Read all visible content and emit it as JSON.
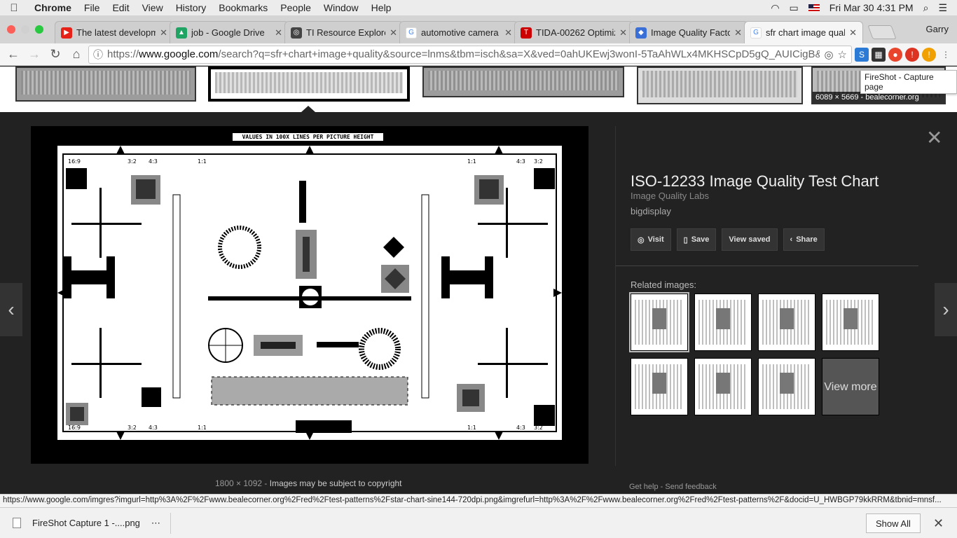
{
  "menubar": {
    "app": "Chrome",
    "items": [
      "File",
      "Edit",
      "View",
      "History",
      "Bookmarks",
      "People",
      "Window",
      "Help"
    ],
    "clock": "Fri Mar 30  4:31 PM"
  },
  "tabs": [
    {
      "label": "The latest developm",
      "icon": "youtube-icon",
      "color": "#e62117"
    },
    {
      "label": "job - Google Drive",
      "icon": "drive-icon",
      "color": "#1fa463"
    },
    {
      "label": "TI Resource Explorer",
      "icon": "compass-icon",
      "color": "#444444"
    },
    {
      "label": "automotive camera t",
      "icon": "google-icon",
      "color": "#4285f4"
    },
    {
      "label": "TIDA-00262 Optimiz",
      "icon": "ti-icon",
      "color": "#cc0000"
    },
    {
      "label": "Image Quality Factor",
      "icon": "imatest-icon",
      "color": "#3b6fd8"
    },
    {
      "label": "sfr chart image quali",
      "icon": "google-icon",
      "color": "#4285f4"
    }
  ],
  "profile": "Garry",
  "omnibox": {
    "scheme": "https://",
    "host": "www.google.com",
    "path": "/search?q=sfr+chart+image+quality&source=lnms&tbm=isch&sa=X&ved=0ahUKEwj3wonI-5TaAhWLx4MKHSCpD5gQ_AUICigB&b..."
  },
  "tooltip": "FireShot - Capture page",
  "strip_caption": "6089 × 5669 - bealecorner.org",
  "chart_header": "VALUES IN 100X LINES PER PICTURE HEIGHT",
  "image_info": {
    "size": "1800 × 1092",
    "copyright": "Images may be subject to copyright"
  },
  "details": {
    "title": "ISO-12233 Image Quality Test Chart",
    "site": "Image Quality Labs",
    "subsite": "bigdisplay",
    "actions": [
      "Visit",
      "Save",
      "View saved",
      "Share"
    ],
    "related_label": "Related images:",
    "view_more": "View more"
  },
  "footer": {
    "help": "Get help",
    "feedback": "Send feedback",
    "separator": "-"
  },
  "status_url": "https://www.google.com/imgres?imgurl=http%3A%2F%2Fwww.bealecorner.org%2Fred%2Ftest-patterns%2Fstar-chart-sine144-720dpi.png&imgrefurl=http%3A%2F%2Fwww.bealecorner.org%2Fred%2Ftest-patterns%2F&docid=U_HWBGP79kkRRM&tbnid=mnsf...",
  "downloads": {
    "file": "FireShot Capture 1 -....png",
    "show_all": "Show All"
  }
}
